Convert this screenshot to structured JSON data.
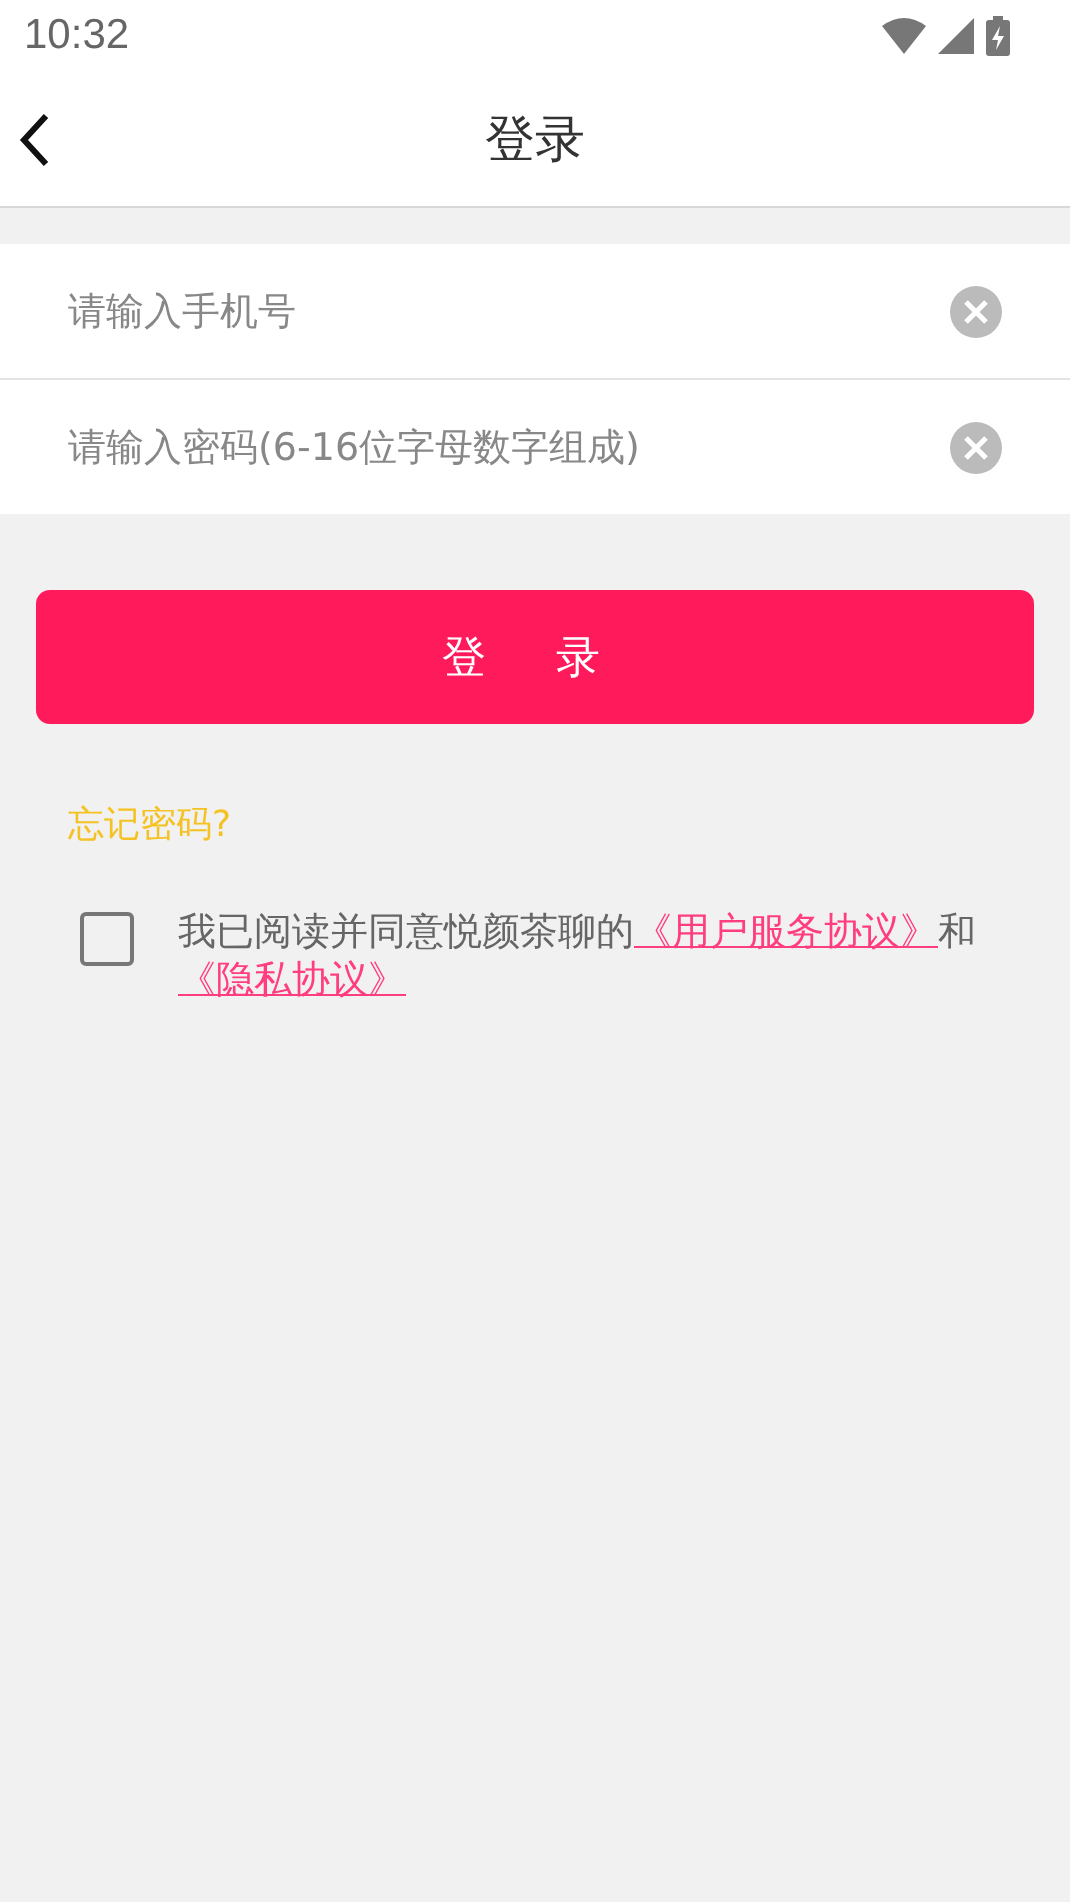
{
  "status_bar": {
    "time": "10:32"
  },
  "header": {
    "title": "登录"
  },
  "fields": [
    {
      "placeholder": "请输入手机号"
    },
    {
      "placeholder": "请输入密码(6-16位字母数字组成)"
    }
  ],
  "login_button": "登 录",
  "forgot_link": "忘记密码?",
  "agreement": {
    "checked": false,
    "text": "我已阅读并同意悦颜茶聊的",
    "links": [
      "《用户服务协议》",
      "《隐私协议》"
    ],
    "joiner": "和"
  }
}
